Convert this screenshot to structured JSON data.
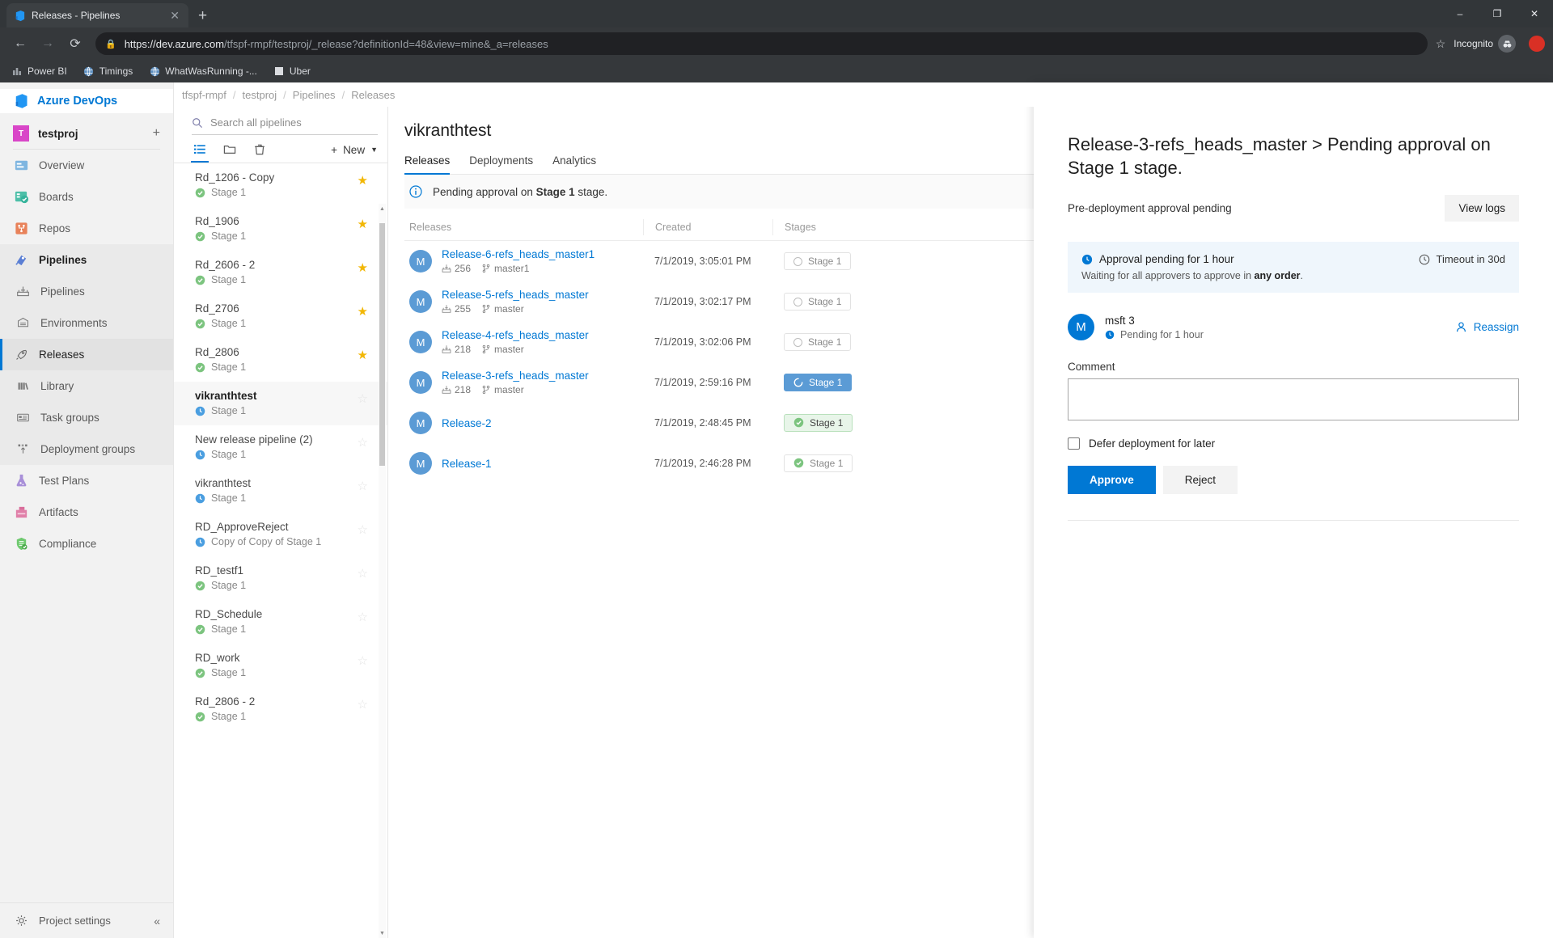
{
  "browser": {
    "tab": {
      "title": "Releases - Pipelines",
      "favicon_icon": "azure-devops-icon",
      "close_icon": "close-icon"
    },
    "new_tab_label": "+",
    "window_controls": {
      "minimize": "–",
      "maximize": "❐",
      "close": "✕"
    },
    "nav": {
      "back_icon": "arrow-left-icon",
      "forward_icon": "arrow-right-icon",
      "reload_icon": "reload-icon"
    },
    "omnibox": {
      "lock_icon": "lock-icon",
      "scheme": "https://",
      "host": "dev.azure.com",
      "path": "/tfspf-rmpf/testproj/_release?definitionId=48&view=mine&_a=releases",
      "star_icon": "star-outline-icon"
    },
    "incognito_label": "Incognito",
    "bookmarks": [
      {
        "label": "Power BI",
        "icon": "powerbi-icon"
      },
      {
        "label": "Timings",
        "icon": "globe-icon"
      },
      {
        "label": "WhatWasRunning -...",
        "icon": "globe-icon"
      },
      {
        "label": "Uber",
        "icon": "square-icon"
      }
    ]
  },
  "rail": {
    "brand": "Azure DevOps",
    "brand_icon": "azure-devops-icon",
    "project": {
      "initial": "T",
      "name": "testproj",
      "add_icon": "plus-icon"
    },
    "items": [
      {
        "label": "Overview",
        "icon": "overview-icon",
        "state": "normal"
      },
      {
        "label": "Boards",
        "icon": "boards-icon",
        "state": "normal"
      },
      {
        "label": "Repos",
        "icon": "repos-icon",
        "state": "normal"
      },
      {
        "label": "Pipelines",
        "icon": "pipelines-icon",
        "state": "group-header"
      },
      {
        "label": "Pipelines",
        "icon": "pipeline-sub-icon",
        "state": "group-child"
      },
      {
        "label": "Environments",
        "icon": "environments-icon",
        "state": "group-child"
      },
      {
        "label": "Releases",
        "icon": "releases-rocket-icon",
        "state": "active"
      },
      {
        "label": "Library",
        "icon": "library-icon",
        "state": "group-child"
      },
      {
        "label": "Task groups",
        "icon": "task-groups-icon",
        "state": "group-child"
      },
      {
        "label": "Deployment groups",
        "icon": "deployment-groups-icon",
        "state": "group-child"
      },
      {
        "label": "Test Plans",
        "icon": "test-plans-icon",
        "state": "normal"
      },
      {
        "label": "Artifacts",
        "icon": "artifacts-icon",
        "state": "normal"
      },
      {
        "label": "Compliance",
        "icon": "compliance-icon",
        "state": "normal"
      }
    ],
    "footer": {
      "label": "Project settings",
      "icon": "gear-icon",
      "collapse_icon": "chevron-double-left-icon"
    }
  },
  "breadcrumb": [
    "tfspf-rmpf",
    "testproj",
    "Pipelines",
    "Releases"
  ],
  "pipelines_panel": {
    "search": {
      "placeholder": "Search all pipelines",
      "value": "",
      "icon": "search-icon"
    },
    "toolbar": [
      {
        "name": "all-pipelines-view",
        "icon": "list-icon",
        "selected": true
      },
      {
        "name": "folders-view",
        "icon": "folder-icon",
        "selected": false
      },
      {
        "name": "recycle-bin-view",
        "icon": "trash-icon",
        "selected": false
      }
    ],
    "new_button": {
      "label": "New",
      "plus_icon": "plus-icon",
      "chevron_icon": "chevron-down-icon"
    },
    "items": [
      {
        "name": "Rd_1206 - Copy",
        "stage": "Stage 1",
        "status": "succeeded",
        "starred": true,
        "selected": false
      },
      {
        "name": "Rd_1906",
        "stage": "Stage 1",
        "status": "succeeded",
        "starred": true,
        "selected": false
      },
      {
        "name": "Rd_2606 - 2",
        "stage": "Stage 1",
        "status": "succeeded",
        "starred": true,
        "selected": false
      },
      {
        "name": "Rd_2706",
        "stage": "Stage 1",
        "status": "succeeded",
        "starred": true,
        "selected": false
      },
      {
        "name": "Rd_2806",
        "stage": "Stage 1",
        "status": "succeeded",
        "starred": true,
        "selected": false
      },
      {
        "name": "vikranthtest",
        "stage": "Stage 1",
        "status": "pending",
        "starred": false,
        "selected": true
      },
      {
        "name": "New release pipeline (2)",
        "stage": "Stage 1",
        "status": "pending",
        "starred": false,
        "selected": false
      },
      {
        "name": "vikranthtest",
        "stage": "Stage 1",
        "status": "pending",
        "starred": false,
        "selected": false
      },
      {
        "name": "RD_ApproveReject",
        "stage": "Copy of Copy of Stage 1",
        "status": "pending",
        "starred": false,
        "selected": false
      },
      {
        "name": "RD_testf1",
        "stage": "Stage 1",
        "status": "succeeded",
        "starred": false,
        "selected": false
      },
      {
        "name": "RD_Schedule",
        "stage": "Stage 1",
        "status": "succeeded",
        "starred": false,
        "selected": false
      },
      {
        "name": "RD_work",
        "stage": "Stage 1",
        "status": "succeeded",
        "starred": false,
        "selected": false
      },
      {
        "name": "Rd_2806 - 2",
        "stage": "Stage 1",
        "status": "succeeded",
        "starred": false,
        "selected": false
      }
    ]
  },
  "main": {
    "title": "vikranthtest",
    "tabs": [
      {
        "label": "Releases",
        "active": true
      },
      {
        "label": "Deployments",
        "active": false
      },
      {
        "label": "Analytics",
        "active": false
      }
    ],
    "banner": {
      "icon": "info-icon",
      "text_before": "Pending approval on ",
      "bold": "Stage 1",
      "text_after": " stage."
    },
    "columns": {
      "releases": "Releases",
      "created": "Created",
      "stages": "Stages"
    },
    "rows": [
      {
        "avatar": "M",
        "name": "Release-6-refs_heads_master1",
        "build": "256",
        "branch": "master1",
        "created": "7/1/2019, 3:05:01 PM",
        "stage_label": "Stage 1",
        "stage_status": "notstarted"
      },
      {
        "avatar": "M",
        "name": "Release-5-refs_heads_master",
        "build": "255",
        "branch": "master",
        "created": "7/1/2019, 3:02:17 PM",
        "stage_label": "Stage 1",
        "stage_status": "notstarted"
      },
      {
        "avatar": "M",
        "name": "Release-4-refs_heads_master",
        "build": "218",
        "branch": "master",
        "created": "7/1/2019, 3:02:06 PM",
        "stage_label": "Stage 1",
        "stage_status": "notstarted"
      },
      {
        "avatar": "M",
        "name": "Release-3-refs_heads_master",
        "build": "218",
        "branch": "master",
        "created": "7/1/2019, 2:59:16 PM",
        "stage_label": "Stage 1",
        "stage_status": "inprogress"
      },
      {
        "avatar": "M",
        "name": "Release-2",
        "build": "",
        "branch": "",
        "created": "7/1/2019, 2:48:45 PM",
        "stage_label": "Stage 1",
        "stage_status": "succeeded"
      },
      {
        "avatar": "M",
        "name": "Release-1",
        "build": "",
        "branch": "",
        "created": "7/1/2019, 2:46:28 PM",
        "stage_label": "Stage 1",
        "stage_status": "succeeded-plain"
      }
    ]
  },
  "panel": {
    "close_icon": "close-icon",
    "title": "Release-3-refs_heads_master > Pending approval on Stage 1 stage.",
    "subtitle": "Pre-deployment approval pending",
    "view_logs_label": "View logs",
    "info": {
      "clock_icon": "clock-icon",
      "pending_text": "Approval pending for 1 hour",
      "timeout_text": "Timeout in 30d",
      "waiting_before": "Waiting for all approvers to approve in ",
      "waiting_bold": "any order",
      "waiting_after": "."
    },
    "approver": {
      "avatar": "M",
      "name": "msft 3",
      "state": "Pending for 1 hour",
      "reassign_label": "Reassign",
      "reassign_icon": "person-icon"
    },
    "comment": {
      "label": "Comment",
      "value": "",
      "placeholder": ""
    },
    "defer": {
      "label": "Defer deployment for later",
      "checked": false
    },
    "approve_label": "Approve",
    "reject_label": "Reject"
  },
  "colors": {
    "accent": "#0078d4",
    "success": "#79c67a",
    "inprogress": "#5b9bd5",
    "star": "#f2b705",
    "info_bg": "#eff6fc"
  }
}
